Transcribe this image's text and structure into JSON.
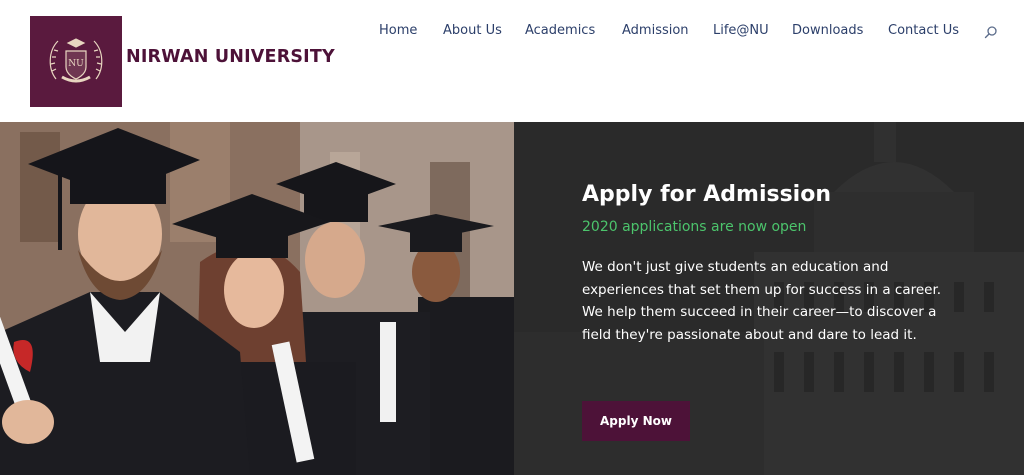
{
  "brand": {
    "name": "NIRWAN UNIVERSITY",
    "logo_color": "#5a1a3e"
  },
  "nav": {
    "items": [
      {
        "label": "Home"
      },
      {
        "label": "About Us"
      },
      {
        "label": "Academics"
      },
      {
        "label": "Admission"
      },
      {
        "label": "Life@NU"
      },
      {
        "label": "Downloads"
      },
      {
        "label": "Contact Us"
      }
    ],
    "search_icon": "search-icon",
    "text_color": "#2c3f6a"
  },
  "hero": {
    "title": "Apply for Admission",
    "subtitle": "2020 applications are now open",
    "subtitle_color": "#4cc46c",
    "body": "We don't just give students an education and experiences that set them up for success in a career. We help them succeed in their career—to discover a field they're passionate about and dare to lead it.",
    "cta_label": "Apply Now",
    "cta_color": "#4d1238"
  }
}
